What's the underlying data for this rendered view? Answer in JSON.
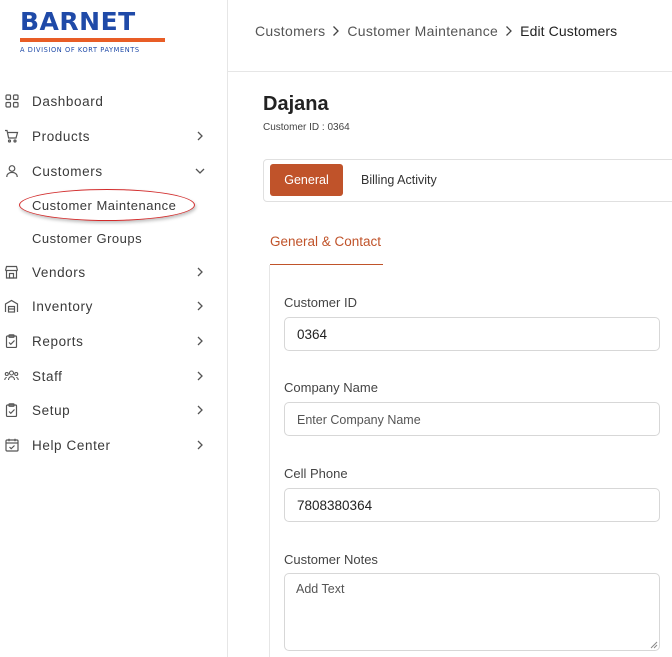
{
  "brand": {
    "name": "BARNET",
    "tagline": "A DIVISION OF KORT PAYMENTS",
    "primary_color": "#1f4aa8",
    "accent_color": "#e85d26"
  },
  "sidebar": {
    "items": [
      {
        "label": "Dashboard",
        "icon": "grid-icon",
        "has_chevron": false
      },
      {
        "label": "Products",
        "icon": "cart-icon",
        "has_chevron": true
      },
      {
        "label": "Customers",
        "icon": "user-icon",
        "has_chevron": true,
        "expanded": true
      },
      {
        "label": "Vendors",
        "icon": "store-icon",
        "has_chevron": true
      },
      {
        "label": "Inventory",
        "icon": "warehouse-icon",
        "has_chevron": true
      },
      {
        "label": "Reports",
        "icon": "clipboard-icon",
        "has_chevron": true
      },
      {
        "label": "Staff",
        "icon": "users-icon",
        "has_chevron": true
      },
      {
        "label": "Setup",
        "icon": "clipboard-icon",
        "has_chevron": true
      },
      {
        "label": "Help Center",
        "icon": "calendar-check-icon",
        "has_chevron": true
      }
    ],
    "sub_items": [
      {
        "label": "Customer Maintenance",
        "active": true
      },
      {
        "label": "Customer Groups",
        "active": false
      }
    ]
  },
  "breadcrumb": {
    "items": [
      "Customers",
      "Customer Maintenance",
      "Edit Customers"
    ]
  },
  "customer": {
    "name": "Dajana",
    "id_line": "Customer ID : 0364"
  },
  "tabs": {
    "active": "General",
    "other": "Billing Activity",
    "active_color": "#c0532a"
  },
  "section": {
    "title": "General & Contact"
  },
  "form": {
    "customer_id": {
      "label": "Customer ID",
      "value": "0364"
    },
    "company_name": {
      "label": "Company Name",
      "value": "",
      "placeholder": "Enter Company Name"
    },
    "cell_phone": {
      "label": "Cell Phone",
      "value": "7808380364"
    },
    "customer_notes": {
      "label": "Customer Notes",
      "value": "",
      "placeholder": "Add Text"
    }
  }
}
